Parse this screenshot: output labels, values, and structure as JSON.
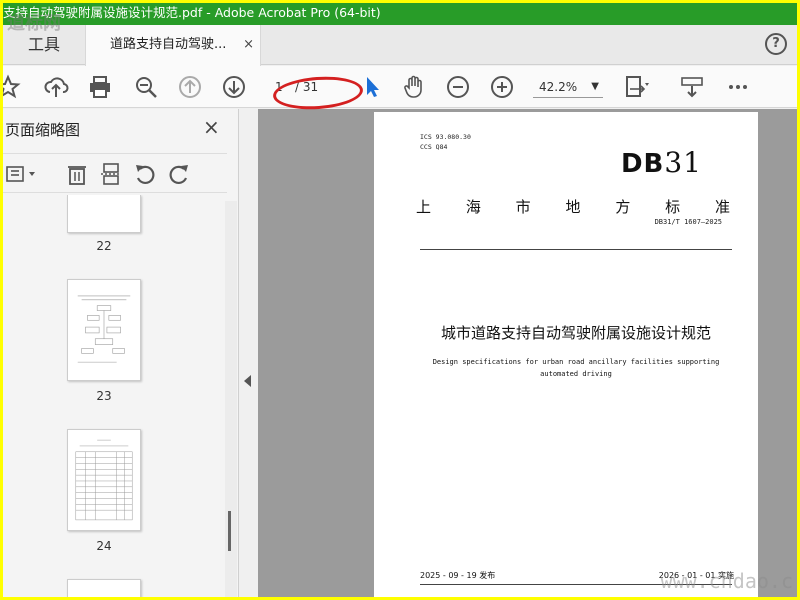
{
  "window": {
    "title": "支持自动驾驶附属设施设计规范.pdf - Adobe Acrobat Pro (64-bit)"
  },
  "tabs": {
    "tools_label": "工具",
    "doc_label": "道路支持自动驾驶...",
    "doc_close": "×",
    "help": "?"
  },
  "toolbar": {
    "current_page": "1",
    "total_pages": "/ 31",
    "zoom": "42.2%",
    "zoom_arrow": "▼"
  },
  "left_panel": {
    "title": "页面缩略图",
    "close": "×",
    "thumbnails": [
      {
        "label": "22"
      },
      {
        "label": "23"
      },
      {
        "label": "24"
      }
    ]
  },
  "document": {
    "ics": "ICS  93.080.30",
    "ccs": "CCS  Q84",
    "logo_db": "DB",
    "logo_num": "31",
    "standard_chars": [
      "上",
      "海",
      "市",
      "地",
      "方",
      "标",
      "准"
    ],
    "code": "DB31/T 1607—2025",
    "title_cn": "城市道路支持自动驾驶附属设施设计规范",
    "title_en": "Design specifications for urban road ancillary facilities supporting automated driving",
    "publish_date": "2025 - 09 - 19 发布",
    "implement_date": "2026 - 01 - 01 实施"
  },
  "watermarks": {
    "top_left": "道标网",
    "bottom_right": "www.chdao.c"
  }
}
